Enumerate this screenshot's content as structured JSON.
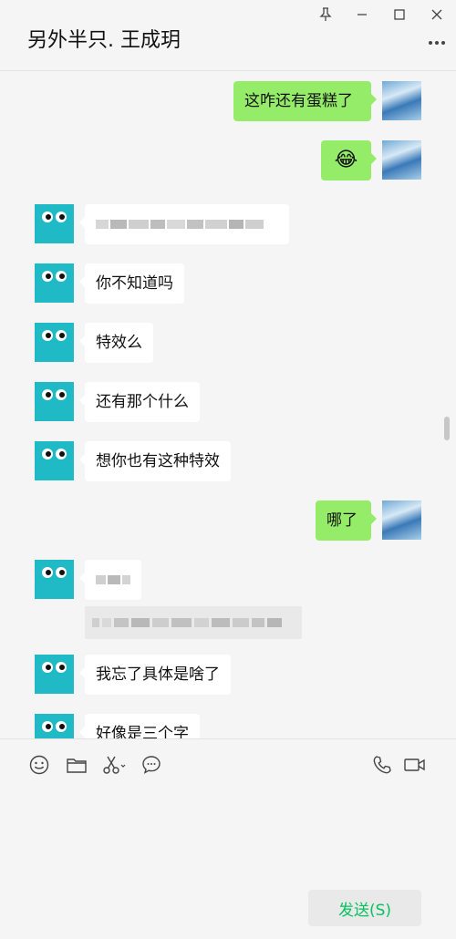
{
  "header": {
    "title": "另外半只. 王成玥"
  },
  "messages": [
    {
      "side": "out",
      "text": "这咋还有蛋糕了"
    },
    {
      "side": "out",
      "emoji": "😂"
    },
    {
      "side": "in",
      "blurred": true
    },
    {
      "side": "in",
      "text": "你不知道吗"
    },
    {
      "side": "in",
      "text": "特效么"
    },
    {
      "side": "in",
      "text": "还有那个什么"
    },
    {
      "side": "in",
      "text": "想你也有这种特效"
    },
    {
      "side": "out",
      "text": "哪了"
    },
    {
      "side": "in",
      "blurred": true,
      "quote_blurred": true
    },
    {
      "side": "in",
      "text": "我忘了具体是啥了"
    },
    {
      "side": "in",
      "text": "好像是三个字"
    }
  ],
  "composer": {
    "send_label": "发送(S)",
    "tools": [
      "smiley-icon",
      "folder-icon",
      "scissors-icon",
      "chat-bubble-icon",
      "phone-icon",
      "video-camera-icon"
    ]
  },
  "colors": {
    "outgoing_bubble": "#95ec69",
    "incoming_bubble": "#ffffff",
    "send_text": "#07c160",
    "avatar_bg": "#1fbac6"
  }
}
